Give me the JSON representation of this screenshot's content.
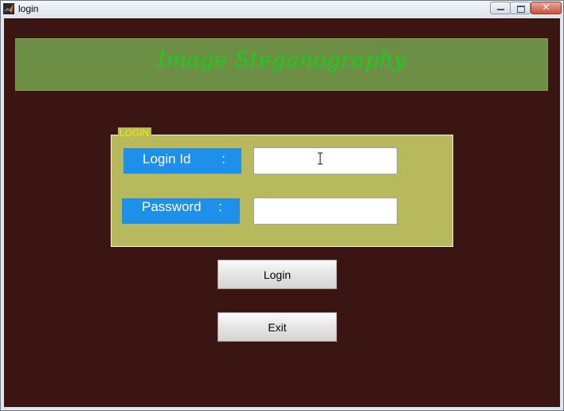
{
  "window": {
    "title": "login",
    "icon": "matlab-icon",
    "controls": {
      "minimize_icon": "minimize-icon",
      "maximize_icon": "maximize-icon",
      "close_icon": "close-icon",
      "close_glyph": "✕"
    }
  },
  "banner": {
    "title": "Image Steganography",
    "background": "#6d8f45",
    "text_color": "#19cf19"
  },
  "login_panel": {
    "legend": "LOGIN",
    "background": "#b8b85c",
    "fields": {
      "login_id": {
        "label": "Login Id",
        "colon": ":",
        "value": "",
        "cursor_icon": "text-cursor-icon"
      },
      "password": {
        "label": "Password",
        "colon": ":",
        "value": ""
      }
    },
    "label_background": "#1e90ea"
  },
  "buttons": {
    "login": "Login",
    "exit": "Exit"
  },
  "colors": {
    "window_background": "#3a1512"
  }
}
